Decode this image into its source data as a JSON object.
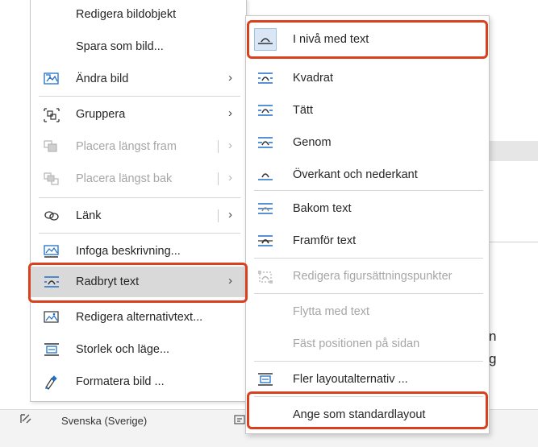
{
  "context_menu": {
    "items": [
      {
        "label": "Redigera bildobjekt",
        "icon": "none",
        "enabled": true
      },
      {
        "label": "Spara som bild...",
        "icon": "none",
        "enabled": true
      },
      {
        "label": "Ändra bild",
        "icon": "change-picture-icon",
        "enabled": true,
        "submenu": true
      },
      {
        "label": "Gruppera",
        "icon": "group-icon",
        "enabled": true,
        "submenu": true
      },
      {
        "label": "Placera längst fram",
        "icon": "bring-to-front-icon",
        "enabled": false,
        "submenu": true
      },
      {
        "label": "Placera längst bak",
        "icon": "send-to-back-icon",
        "enabled": false,
        "submenu": true
      },
      {
        "label": "Länk",
        "icon": "link-icon",
        "enabled": true,
        "submenu": true
      },
      {
        "label": "Infoga beskrivning...",
        "icon": "insert-caption-icon",
        "enabled": true
      },
      {
        "label": "Radbryt text",
        "icon": "wrap-text-icon",
        "enabled": true,
        "submenu": true,
        "highlighted": true
      },
      {
        "label": "Redigera alternativtext...",
        "icon": "alt-text-icon",
        "enabled": true
      },
      {
        "label": "Storlek och läge...",
        "icon": "size-position-icon",
        "enabled": true
      },
      {
        "label": "Formatera bild ...",
        "icon": "format-picture-icon",
        "enabled": true
      }
    ]
  },
  "wrap_submenu": {
    "items": [
      {
        "label": "I nivå med text",
        "icon": "inline-with-text-icon",
        "enabled": true,
        "selected": true
      },
      {
        "label": "Kvadrat",
        "icon": "square-wrap-icon",
        "enabled": true
      },
      {
        "label": "Tätt",
        "icon": "tight-wrap-icon",
        "enabled": true
      },
      {
        "label": "Genom",
        "icon": "through-wrap-icon",
        "enabled": true
      },
      {
        "label": "Överkant och nederkant",
        "icon": "top-bottom-wrap-icon",
        "enabled": true
      },
      {
        "label": "Bakom text",
        "icon": "behind-text-icon",
        "enabled": true
      },
      {
        "label": "Framför text",
        "icon": "in-front-of-text-icon",
        "enabled": true
      },
      {
        "label": "Redigera figursättningspunkter",
        "icon": "edit-wrap-points-icon",
        "enabled": false
      },
      {
        "label": "Flytta med text",
        "icon": "none",
        "enabled": false
      },
      {
        "label": "Fäst positionen på sidan",
        "icon": "none",
        "enabled": false
      },
      {
        "label": "Fler layoutalternativ ...",
        "icon": "more-layout-icon",
        "enabled": true
      },
      {
        "label": "Ange som standardlayout",
        "icon": "none",
        "enabled": true
      }
    ]
  },
  "statusbar": {
    "language": "Svenska (Sverige)"
  },
  "document_text": {
    "char1": "n",
    "char2": "g"
  },
  "colors": {
    "highlight": "#d9d9d9",
    "annotation": "#d9411e",
    "accent_icon": "#1e6fc7",
    "disabled": "#a6a6a6"
  }
}
